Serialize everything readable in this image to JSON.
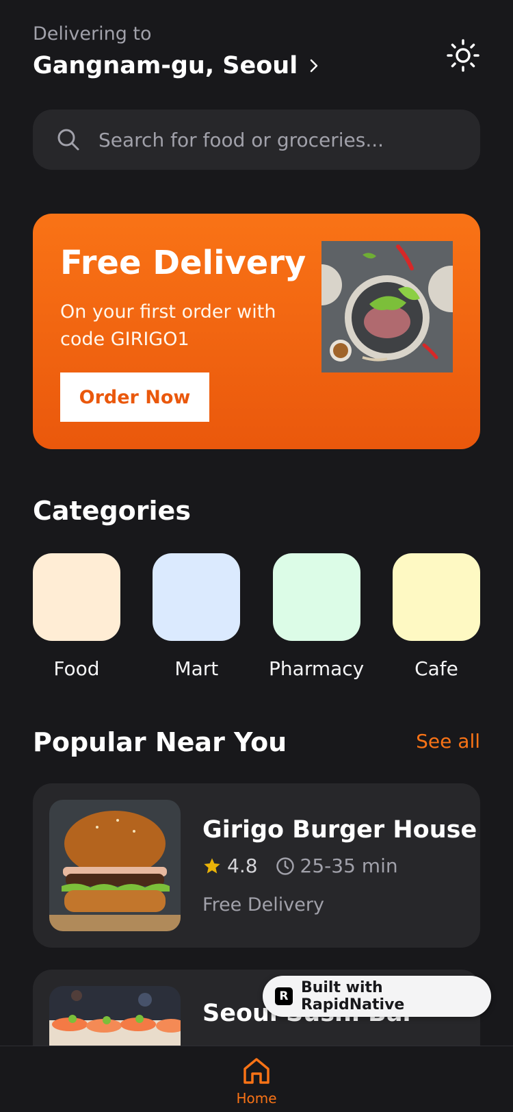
{
  "header": {
    "deliver_label": "Delivering to",
    "location": "Gangnam-gu, Seoul"
  },
  "search": {
    "placeholder": "Search for food or groceries..."
  },
  "promo": {
    "title": "Free Delivery",
    "subtitle": "On your first order with code GIRIGO1",
    "button": "Order Now"
  },
  "categories": {
    "title": "Categories",
    "items": [
      {
        "label": "Food",
        "color": "#ffedd5"
      },
      {
        "label": "Mart",
        "color": "#dbeafe"
      },
      {
        "label": "Pharmacy",
        "color": "#dcfce7"
      },
      {
        "label": "Cafe",
        "color": "#fef9c3"
      }
    ]
  },
  "popular": {
    "title": "Popular Near You",
    "see_all": "See all",
    "items": [
      {
        "name": "Girigo Burger House",
        "rating": "4.8",
        "time": "25-35 min",
        "delivery": "Free Delivery"
      },
      {
        "name": "Seoul Sushi Bar"
      }
    ]
  },
  "badge": {
    "text": "Built with RapidNative"
  },
  "tabbar": {
    "home": "Home"
  },
  "colors": {
    "accent": "#f97316",
    "background": "#18181b",
    "card": "#27272a"
  }
}
